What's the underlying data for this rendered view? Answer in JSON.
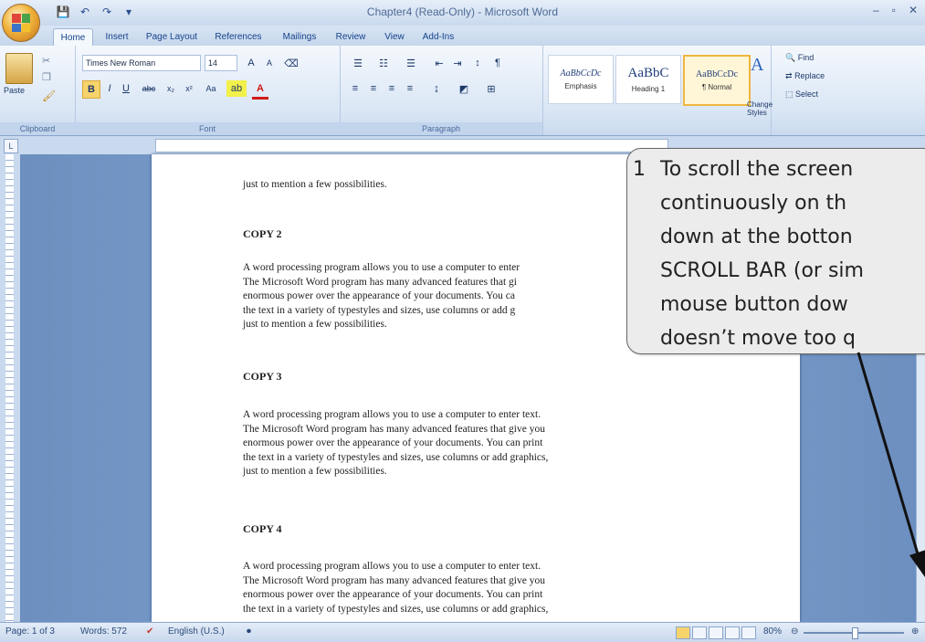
{
  "window": {
    "title": "Chapter4 (Read-Only) - Microsoft Word",
    "controls": [
      "–",
      "▫",
      "✕"
    ]
  },
  "tabs": [
    "Home",
    "Insert",
    "Page Layout",
    "References",
    "Mailings",
    "Review",
    "View",
    "Add-Ins"
  ],
  "ribbon": {
    "clipboard": {
      "paste": "Paste",
      "label": "Clipboard"
    },
    "font": {
      "name": "Times New Roman",
      "size": "14",
      "label": "Font"
    },
    "paragraph": {
      "label": "Paragraph"
    },
    "styles": {
      "items": [
        {
          "sample": "AaBbCcDc",
          "name": "Emphasis"
        },
        {
          "sample": "AaBbC",
          "name": "Heading 1"
        },
        {
          "sample": "AaBbCcDc",
          "name": "¶ Normal"
        }
      ],
      "change": "Change Styles"
    },
    "editing": {
      "find": "Find",
      "replace": "Replace",
      "select": "Select"
    }
  },
  "document": {
    "intro_tail": "just to mention a few possibilities.",
    "sections": [
      {
        "heading": "COPY 2",
        "lines": [
          "A word processing program allows you to use a computer to enter",
          "The Microsoft Word program has many advanced features that gi",
          "enormous power over the appearance of your documents.  You ca",
          "the text in a variety of typestyles and sizes, use columns or add g",
          "just to mention a few possibilities."
        ]
      },
      {
        "heading": "COPY 3",
        "lines": [
          "A word processing program allows you to use a computer to enter text.",
          "The Microsoft Word program has many advanced features that give you",
          "enormous power over the appearance of your documents.  You can print",
          "the text in a variety of typestyles and sizes, use columns or add graphics,",
          "just to mention a few possibilities."
        ]
      },
      {
        "heading": "COPY 4",
        "lines": [
          "A word processing program allows you to use a computer to enter text.",
          "The Microsoft Word program has many advanced features that give you",
          "enormous power over the appearance of your documents.  You can print",
          "the text in a variety of typestyles and sizes, use columns or add graphics,"
        ]
      }
    ]
  },
  "status": {
    "page": "Page: 1 of 3",
    "words": "Words: 572",
    "language": "English (U.S.)",
    "zoom": "80%"
  },
  "callout": {
    "number": "1",
    "lines": [
      "To scroll the screen",
      "continuously on th",
      "down at the botton",
      "SCROLL BAR (or sim",
      "mouse button dow",
      "doesn’t move too q"
    ]
  }
}
